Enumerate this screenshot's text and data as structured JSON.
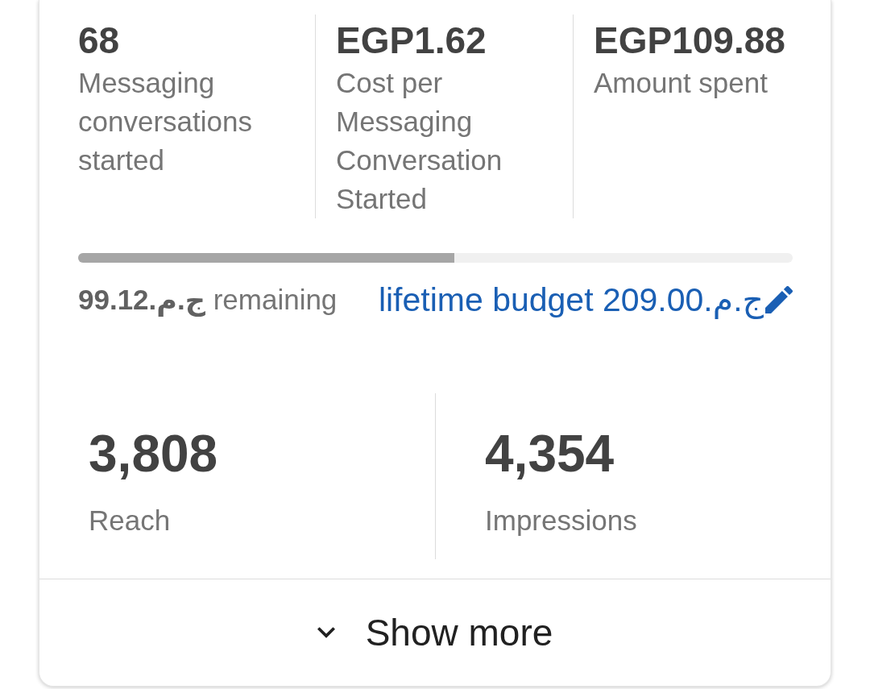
{
  "summary_stats": [
    {
      "value": "68",
      "label": "Messaging conversations started"
    },
    {
      "value": "EGP1.62",
      "label": "Cost per Messaging Conversation Started"
    },
    {
      "value": "EGP109.88",
      "label": "Amount spent"
    }
  ],
  "budget": {
    "level": 0.526,
    "remaining": "**ج.م.99.12** remaining",
    "budget_link": "lifetime budget ج.م.209.00"
  },
  "results": [
    {
      "value": "3,808",
      "label": "Reach"
    },
    {
      "value": "4,354",
      "label": "Impressions"
    }
  ],
  "show_more": {
    "label": "Show more",
    "expanded": false
  }
}
